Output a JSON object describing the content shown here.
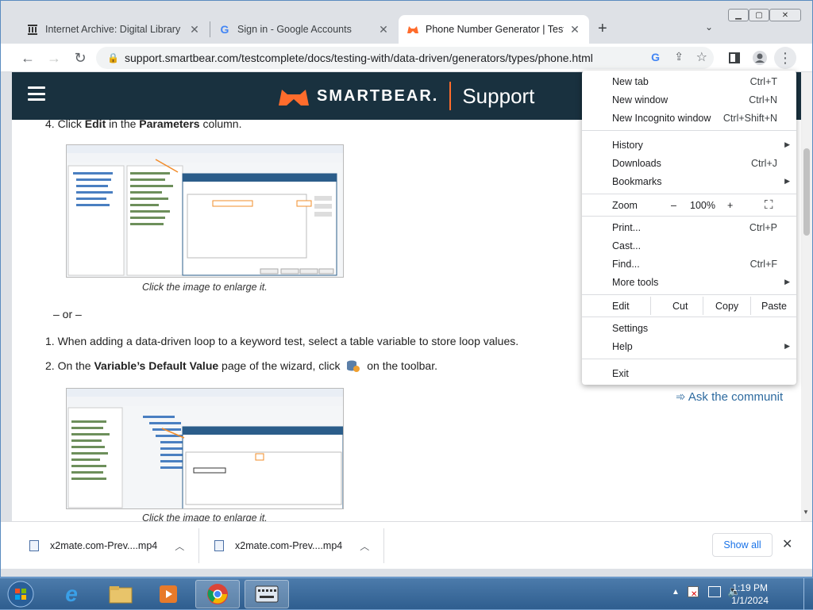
{
  "tabs": [
    {
      "title": "Internet Archive: Digital Library o",
      "icon": "archive-icon"
    },
    {
      "title": "Sign in - Google Accounts",
      "icon": "google-icon"
    },
    {
      "title": "Phone Number Generator | TestC",
      "icon": "smartbear-icon"
    }
  ],
  "address": {
    "url": "support.smartbear.com/testcomplete/docs/testing-with/data-driven/generators/types/phone.html"
  },
  "site": {
    "brand": "SMARTBEAR.",
    "section": "Support",
    "accent": "#ff6c2c",
    "header_bg": "#19313f"
  },
  "content": {
    "step4_prefix": "4. Click ",
    "step4_b1": "Edit",
    "step4_mid": " in the ",
    "step4_b2": "Parameters",
    "step4_suffix": " column.",
    "caption1": "Click the image to enlarge it.",
    "or": "– or –",
    "item1": "1. When adding a data-driven loop to a keyword test, select a table variable to store loop values.",
    "item2_prefix": "2. On the ",
    "item2_bold": "Variable’s Default Value",
    "item2_mid": " page of the wizard, click",
    "item2_suffix": " on the toolbar.",
    "caption2": "Click the image to enlarge it.",
    "ask": "Ask the communit"
  },
  "menu": {
    "new_tab": {
      "label": "New tab",
      "shortcut": "Ctrl+T"
    },
    "new_window": {
      "label": "New window",
      "shortcut": "Ctrl+N"
    },
    "incognito": {
      "label": "New Incognito window",
      "shortcut": "Ctrl+Shift+N"
    },
    "history": "History",
    "downloads": {
      "label": "Downloads",
      "shortcut": "Ctrl+J"
    },
    "bookmarks": "Bookmarks",
    "zoom": {
      "label": "Zoom",
      "minus": "–",
      "value": "100%",
      "plus": "+"
    },
    "print": {
      "label": "Print...",
      "shortcut": "Ctrl+P"
    },
    "cast": "Cast...",
    "find": {
      "label": "Find...",
      "shortcut": "Ctrl+F"
    },
    "more_tools": "More tools",
    "edit": {
      "label": "Edit",
      "cut": "Cut",
      "copy": "Copy",
      "paste": "Paste"
    },
    "settings": "Settings",
    "help": "Help",
    "exit": "Exit"
  },
  "downloads": [
    {
      "name": "x2mate.com-Prev....mp4"
    },
    {
      "name": "x2mate.com-Prev....mp4"
    }
  ],
  "download_bar": {
    "show_all": "Show all"
  },
  "taskbar": {
    "time": "1:19 PM",
    "date": "1/1/2024"
  }
}
